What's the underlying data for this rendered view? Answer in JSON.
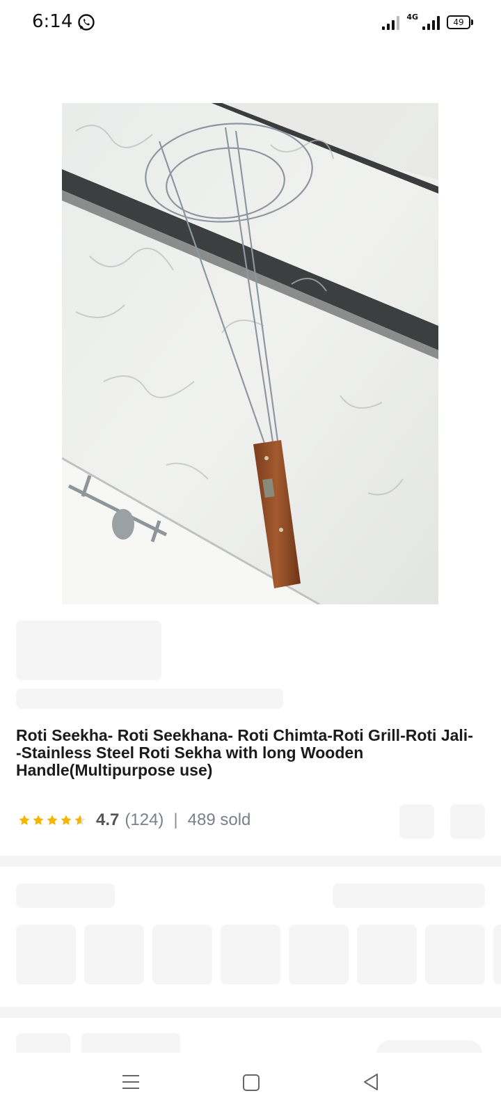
{
  "status_bar": {
    "time": "6:14",
    "network": "4G",
    "battery": "49"
  },
  "product": {
    "title": "Roti Seekha- Roti Seekhana- Roti Chimta-Roti Grill-Roti Jali- -Stainless Steel Roti Sekha with long  Wooden Handle(Multipurpose use)",
    "rating": "4.7",
    "rating_count": "(124)",
    "separator": "|",
    "sold": "489 sold",
    "star_color": "#F5B400"
  },
  "nav": {
    "menu_icon": "menu-icon",
    "home_icon": "home-icon",
    "back_icon": "back-icon"
  }
}
